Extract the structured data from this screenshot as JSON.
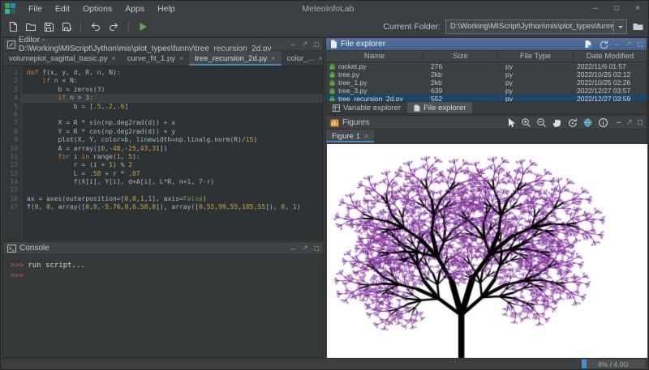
{
  "window": {
    "title": "MeteoInfoLab",
    "menus": [
      "File",
      "Edit",
      "Options",
      "Apps",
      "Help"
    ],
    "controls": {
      "minimize": "–",
      "maximize": "□",
      "close": "×"
    }
  },
  "toolbar": {
    "icons": [
      "new-file",
      "open-file",
      "save",
      "save-as",
      "undo",
      "redo",
      "run-script"
    ],
    "current_folder_label": "Current Folder:",
    "current_folder_value": "D:\\Working\\MIScript\\Jython\\mis\\plot_types\\funny"
  },
  "editor": {
    "title": "Editor - D:\\Working\\MIScript\\Jython\\mis\\plot_types\\funny\\tree_recursion_2d.py",
    "tabs": [
      {
        "label": "volumeplot_sagittal_basic.py",
        "active": false
      },
      {
        "label": "curve_fit_1.py",
        "active": false
      },
      {
        "label": "tree_recursion_2d.py",
        "active": true
      },
      {
        "label": "color_...",
        "active": false
      }
    ],
    "active_line": 4,
    "code_lines": [
      "def f(x, y, d, R, n, N):",
      "    if n < N:",
      "        b = zeros(3)",
      "        if n > 3:",
      "            b = [.5,.2,.6]",
      "",
      "        X = R * sin(np.deg2rad(d)) + x",
      "        Y = R * cos(np.deg2rad(d)) + y",
      "        plot(X, Y, color=b, linewidth=np.linalg.norm(R)/15)",
      "        A = array([0,-48,-25,43,31])",
      "        for i in range(1, 5):",
      "            r = (i + 1) % 2",
      "            L = .58 + r * .07",
      "            f(X[i], Y[i], d+A[i], L*R, n+1, 7-r)",
      "",
      "ax = axes(outerposition=[0,0,1,1], axis=False)",
      "f(0, 0, array([0,0,-5.76,0,6.58,0]), array([0,55,99,55,105,55]), 0, 1)"
    ]
  },
  "console": {
    "title": "Console",
    "lines": [
      {
        "prompt": ">>>",
        "text": "run script..."
      },
      {
        "prompt": ">>>",
        "text": ""
      }
    ]
  },
  "file_explorer": {
    "title": "File explorer",
    "columns": [
      "Name",
      "Size",
      "File Type",
      "Date Modified"
    ],
    "rows": [
      {
        "name": "rocket.py",
        "size": "276",
        "type": "py",
        "modified": "2022/11/6 01:57",
        "selected": false
      },
      {
        "name": "tree.py",
        "size": "2kb",
        "type": "py",
        "modified": "2022/10/25 02:12",
        "selected": false
      },
      {
        "name": "tree_1.py",
        "size": "2kb",
        "type": "py",
        "modified": "2022/10/25 02:26",
        "selected": false
      },
      {
        "name": "tree_3.py",
        "size": "639",
        "type": "py",
        "modified": "2022/12/27 03:57",
        "selected": false
      },
      {
        "name": "tree_recursion_2d.py",
        "size": "552",
        "type": "py",
        "modified": "2022/12/27 03:59",
        "selected": true
      }
    ],
    "bottom_tabs": [
      {
        "label": "Variable explorer",
        "active": false
      },
      {
        "label": "File explorer",
        "active": true
      }
    ]
  },
  "figures": {
    "title": "Figures",
    "tab": "Figure 1",
    "toolbar_icons": [
      "select-arrow",
      "zoom-in",
      "zoom-out",
      "pan-hand",
      "rotate",
      "globe",
      "identify"
    ],
    "tree_params": {
      "d0": [
        0,
        0,
        -5.76,
        0,
        6.58,
        0
      ],
      "R0": [
        0,
        55,
        99,
        55,
        105,
        55
      ],
      "A": [
        0,
        -48,
        -25,
        43,
        31
      ],
      "length_base": 0.58,
      "length_alt_add": 0.07,
      "trunk_color": "#000000",
      "branch_color": "#803399",
      "background": "#ffffff"
    }
  },
  "statusbar": {
    "memory": "8% / 4.0G",
    "memory_fill_color": "#4193d6"
  }
}
